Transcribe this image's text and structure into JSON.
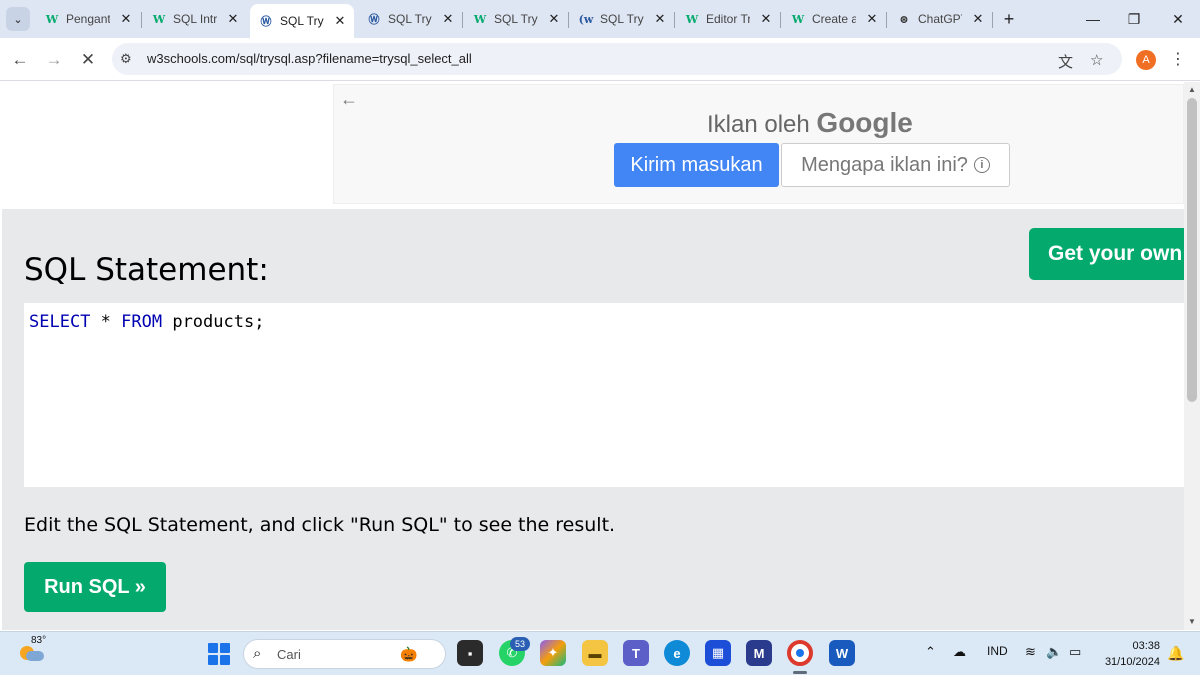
{
  "browser": {
    "tabs": [
      {
        "title": "Pengantar",
        "favicon": "w3-icon",
        "active": false
      },
      {
        "title": "SQL Intro",
        "favicon": "w3-icon",
        "active": false
      },
      {
        "title": "SQL Tryit",
        "favicon": "w3-tryit-icon",
        "active": true
      },
      {
        "title": "SQL Tryit",
        "favicon": "w3-tryit-icon",
        "active": false
      },
      {
        "title": "SQL Tryit",
        "favicon": "w3-icon",
        "active": false
      },
      {
        "title": "SQL Tryit",
        "favicon": "w3-tryit-icon",
        "active": false
      },
      {
        "title": "Editor Tryit",
        "favicon": "w3-icon",
        "active": false
      },
      {
        "title": "Create a",
        "favicon": "w3-icon",
        "active": false
      },
      {
        "title": "ChatGPT",
        "favicon": "chatgpt-icon",
        "active": false
      }
    ],
    "url": "w3schools.com/sql/trysql.asp?filename=trysql_select_all",
    "profile_initial": "A"
  },
  "ad": {
    "label": "Iklan oleh",
    "brand": "Google",
    "feedback_button": "Kirim masukan",
    "why_button": "Mengapa iklan ini?"
  },
  "page": {
    "get_own_button": "Get your own",
    "heading": "SQL Statement:",
    "code": {
      "kw1": "SELECT",
      "mid": " * ",
      "kw2": "FROM",
      "rest": " products;"
    },
    "instruction": "Edit the SQL Statement, and click \"Run SQL\" to see the result.",
    "run_button": "Run SQL »"
  },
  "taskbar": {
    "temperature": "83°",
    "search_placeholder": "Cari",
    "whatsapp_badge": "53",
    "language": "IND",
    "time": "03:38",
    "date": "31/10/2024"
  },
  "colors": {
    "w3_green": "#04aa6d",
    "google_blue": "#4285f4",
    "sql_keyword": "#0000b3"
  }
}
